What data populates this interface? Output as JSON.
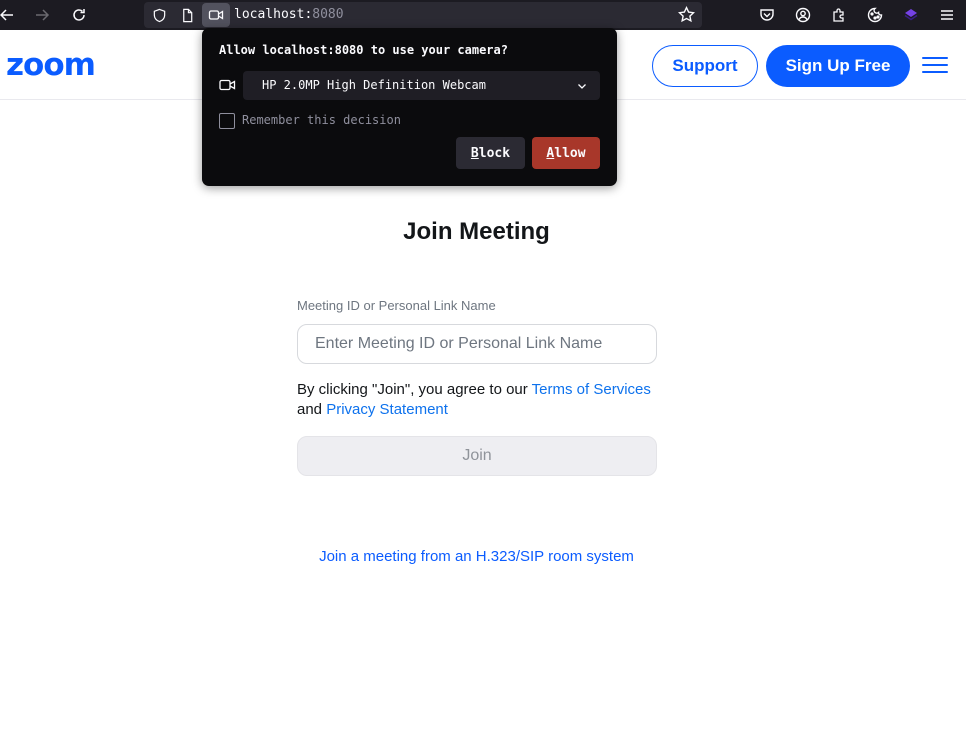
{
  "browser": {
    "url_host": "localhost:",
    "url_port": "8080",
    "icons": [
      "back-arrow-icon",
      "forward-arrow-icon",
      "reload-icon",
      "shield-icon",
      "page-icon",
      "camera-icon",
      "star-icon",
      "pocket-icon",
      "account-icon",
      "extensions-icon",
      "cookie-icon",
      "extension-icon",
      "menu-icon"
    ]
  },
  "header": {
    "logo": "zoom",
    "support_label": "Support",
    "signup_label": "Sign Up Free",
    "brand_color": "#0b5cff"
  },
  "main": {
    "title": "Join Meeting",
    "field_label": "Meeting ID or Personal Link Name",
    "input_placeholder": "Enter Meeting ID or Personal Link Name",
    "input_value": "",
    "agree_prefix": "By clicking \"Join\", you agree to our ",
    "terms_link": "Terms of Services",
    "agree_and": "and ",
    "privacy_link": "Privacy Statement",
    "join_label": "Join",
    "sip_link": "Join a meeting from an H.323/SIP room system"
  },
  "permission_popup": {
    "title": "Allow localhost:8080 to use your camera?",
    "device": "HP 2.0MP High Definition Webcam",
    "remember_label": "Remember this decision",
    "remember_checked": false,
    "block_first": "B",
    "block_rest": "lock",
    "allow_first": "A",
    "allow_rest": "llow",
    "allow_color": "#a8372a"
  }
}
